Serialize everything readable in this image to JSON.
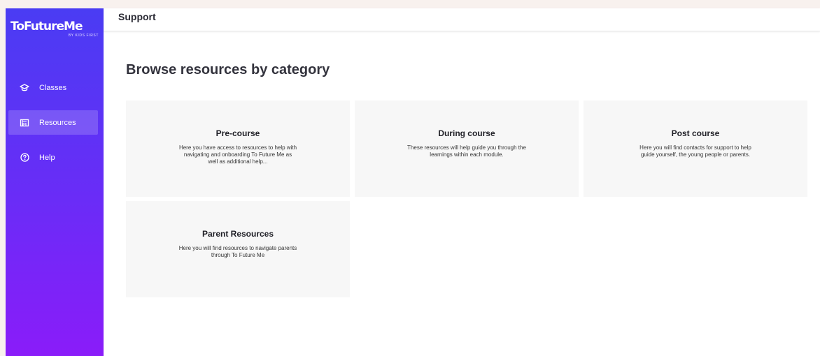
{
  "brand": {
    "name": "ToFutureMe",
    "tagline": "BY KIDS FIRST"
  },
  "sidebar": {
    "items": [
      {
        "label": "Classes",
        "icon": "graduation-cap-icon",
        "active": false
      },
      {
        "label": "Resources",
        "icon": "book-icon",
        "active": true
      },
      {
        "label": "Help",
        "icon": "help-circle-icon",
        "active": false
      }
    ]
  },
  "header": {
    "title": "Support"
  },
  "main": {
    "heading": "Browse resources by category",
    "cards": [
      {
        "title": "Pre-course",
        "description": "Here you have access to resources to help with navigating and onboarding To Future Me as well as additional help..."
      },
      {
        "title": "During course",
        "description": "These resources will help guide you through the learnings within each module."
      },
      {
        "title": "Post course",
        "description": "Here you will find contacts for support to help guide yourself, the young people or parents."
      },
      {
        "title": "Parent Resources",
        "description": "Here you will find resources to navigate parents through To Future Me"
      }
    ]
  },
  "colors": {
    "sidebar_top": "#4a3cf3",
    "sidebar_bottom": "#8a1cf9",
    "card_bg": "#f7f7f7",
    "page_bg": "#f8f1ee"
  }
}
